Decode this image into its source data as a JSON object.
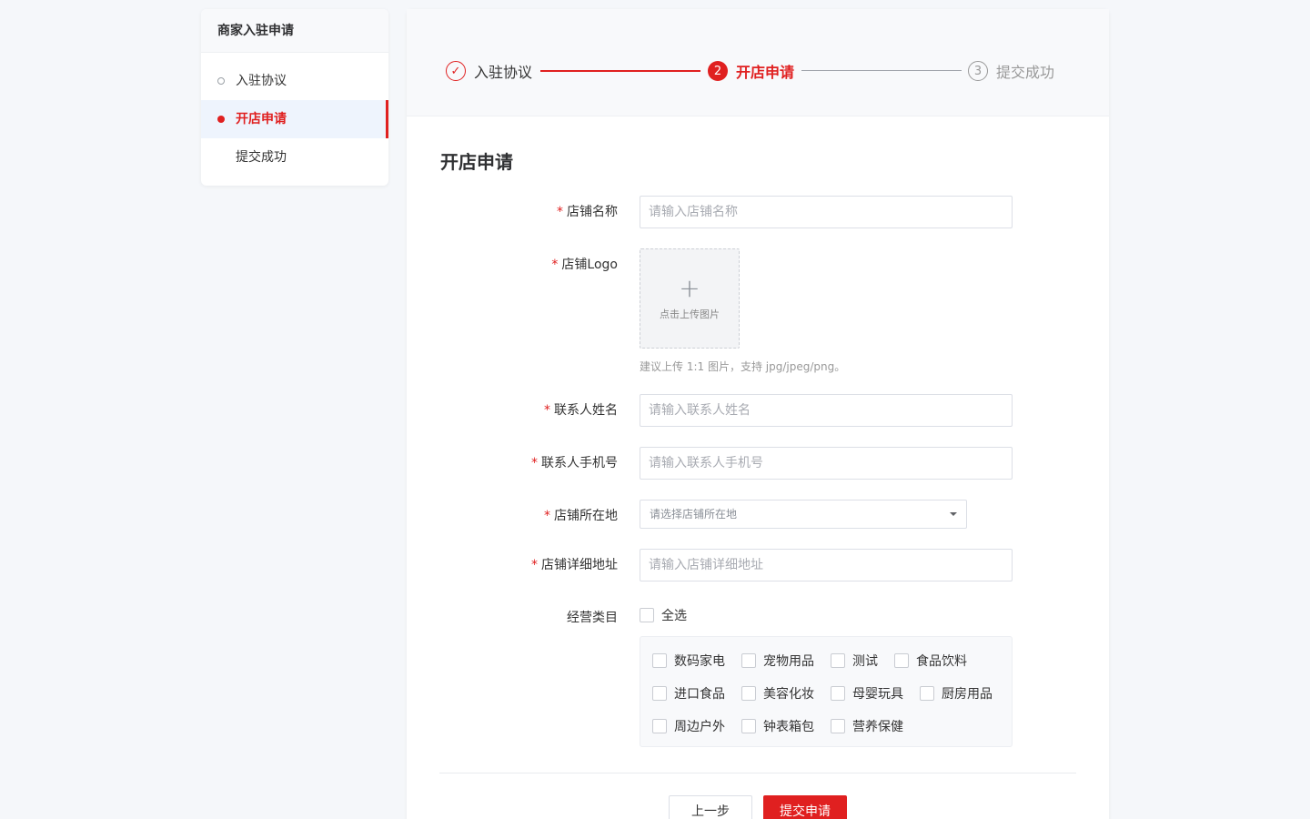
{
  "sidebar": {
    "title": "商家入驻申请",
    "items": [
      {
        "label": "入驻协议"
      },
      {
        "label": "开店申请"
      },
      {
        "label": "提交成功"
      }
    ]
  },
  "steps": [
    {
      "label": "入驻协议",
      "icon": "✓"
    },
    {
      "label": "开店申请",
      "icon": "2"
    },
    {
      "label": "提交成功",
      "icon": "3"
    }
  ],
  "form": {
    "title": "开店申请",
    "required_mark": "*",
    "shop_name": {
      "label": "店铺名称",
      "placeholder": "请输入店铺名称"
    },
    "logo": {
      "label": "店铺Logo",
      "upload_text": "点击上传图片",
      "plus": "+",
      "hint": "建议上传 1:1 图片，支持 jpg/jpeg/png。"
    },
    "contact_name": {
      "label": "联系人姓名",
      "placeholder": "请输入联系人姓名"
    },
    "contact_phone": {
      "label": "联系人手机号",
      "placeholder": "请输入联系人手机号"
    },
    "location": {
      "label": "店铺所在地",
      "placeholder": "请选择店铺所在地"
    },
    "address": {
      "label": "店铺详细地址",
      "placeholder": "请输入店铺详细地址"
    },
    "category": {
      "label": "经营类目",
      "check_all": "全选",
      "options": [
        "数码家电",
        "宠物用品",
        "测试",
        "食品饮料",
        "进口食品",
        "美容化妆",
        "母婴玩具",
        "厨房用品",
        "周边户外",
        "钟表箱包",
        "营养保健"
      ]
    }
  },
  "buttons": {
    "prev": "上一步",
    "submit": "提交申请"
  }
}
